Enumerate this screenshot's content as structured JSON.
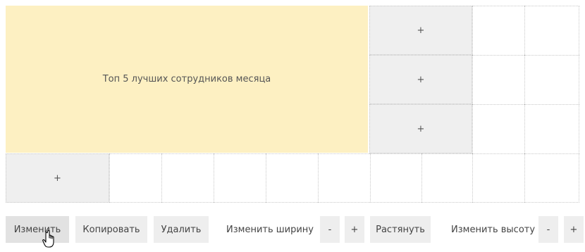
{
  "widget": {
    "title": "Топ 5 лучших сотрудников месяца"
  },
  "add_cells": [
    {
      "label": "+"
    },
    {
      "label": "+"
    },
    {
      "label": "+"
    },
    {
      "label": "+"
    }
  ],
  "toolbar": {
    "edit_label": "Изменить",
    "copy_label": "Копировать",
    "delete_label": "Удалить",
    "width_label": "Изменить ширину",
    "width_decrease": "-",
    "width_increase": "+",
    "stretch_label": "Растянуть",
    "height_label": "Изменить высоту",
    "height_decrease": "-",
    "height_increase": "+"
  },
  "colors": {
    "widget_bg": "#fdf0c2",
    "add_cell_bg": "#efefef",
    "button_bg": "#eeeeee",
    "grid_line": "#c8c8c8"
  },
  "cursor": {
    "icon": "hand-pointer-icon"
  }
}
